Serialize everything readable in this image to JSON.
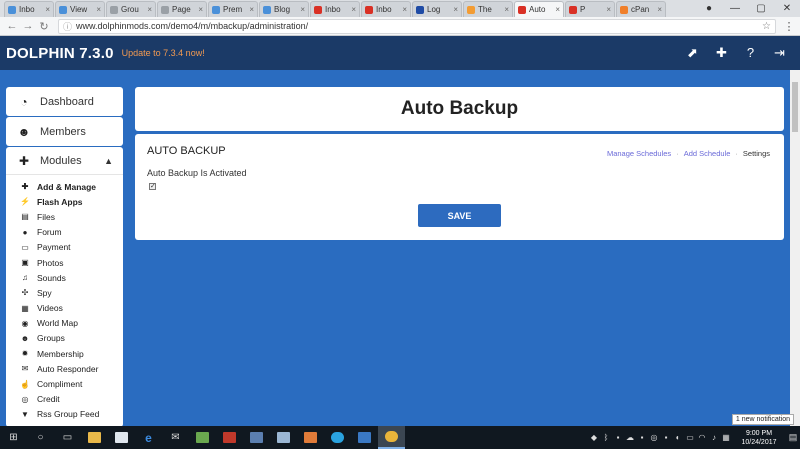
{
  "browser": {
    "tabs": [
      {
        "label": "Inbo",
        "color": "#4a90d9"
      },
      {
        "label": "View",
        "color": "#4a90d9"
      },
      {
        "label": "Grou",
        "color": "#9aa0a6"
      },
      {
        "label": "Page",
        "color": "#9aa0a6"
      },
      {
        "label": "Prem",
        "color": "#4a90d9"
      },
      {
        "label": "Blog",
        "color": "#4a90d9"
      },
      {
        "label": "Inbo",
        "color": "#d93025"
      },
      {
        "label": "Inbo",
        "color": "#d93025"
      },
      {
        "label": "Log",
        "color": "#1f4ba5"
      },
      {
        "label": "The",
        "color": "#f39c33"
      },
      {
        "label": "Auto",
        "color": "#d93025",
        "active": true
      },
      {
        "label": "P",
        "color": "#d93025"
      },
      {
        "label": "cPan",
        "color": "#f07f2a"
      }
    ],
    "url": "www.dolphinmods.com/demo4/m/mbackup/administration/"
  },
  "header": {
    "brand": "DOLPHIN 7.3.0",
    "update_link": "Update to 7.3.4 now!"
  },
  "sidebar": {
    "dashboard": "Dashboard",
    "members": "Members",
    "modules": "Modules",
    "items": [
      {
        "label": "Add & Manage",
        "icon": "plus-icon",
        "glyph": "✚",
        "bold": true
      },
      {
        "label": "Flash Apps",
        "icon": "bolt-icon",
        "glyph": "⚡",
        "bold": true
      },
      {
        "label": "Files",
        "icon": "file-icon",
        "glyph": "▤"
      },
      {
        "label": "Forum",
        "icon": "chat-icon",
        "glyph": "●"
      },
      {
        "label": "Payment",
        "icon": "credit-card-icon",
        "glyph": "▭"
      },
      {
        "label": "Photos",
        "icon": "photo-icon",
        "glyph": "▣"
      },
      {
        "label": "Sounds",
        "icon": "music-icon",
        "glyph": "♫"
      },
      {
        "label": "Spy",
        "icon": "crosshair-icon",
        "glyph": "✣"
      },
      {
        "label": "Videos",
        "icon": "film-icon",
        "glyph": "▦"
      },
      {
        "label": "World Map",
        "icon": "map-pin-icon",
        "glyph": "◉"
      },
      {
        "label": "Groups",
        "icon": "users-icon",
        "glyph": "☻"
      },
      {
        "label": "Membership",
        "icon": "badge-icon",
        "glyph": "✹"
      },
      {
        "label": "Auto Responder",
        "icon": "envelope-icon",
        "glyph": "✉"
      },
      {
        "label": "Compliment",
        "icon": "thumbs-up-icon",
        "glyph": "☝"
      },
      {
        "label": "Credit",
        "icon": "coin-icon",
        "glyph": "◎"
      },
      {
        "label": "Rss Group Feed",
        "icon": "filter-icon",
        "glyph": "▼"
      }
    ]
  },
  "main": {
    "title": "Auto Backup",
    "section_title": "AUTO BACKUP",
    "breadcrumbs": {
      "manage": "Manage Schedules",
      "add": "Add Schedule",
      "settings": "Settings"
    },
    "status_text": "Auto Backup Is Activated",
    "checkbox_checked": true,
    "save_label": "SAVE"
  },
  "notification": "1 new notification",
  "taskbar": {
    "time": "9:00 PM",
    "date": "10/24/2017"
  }
}
